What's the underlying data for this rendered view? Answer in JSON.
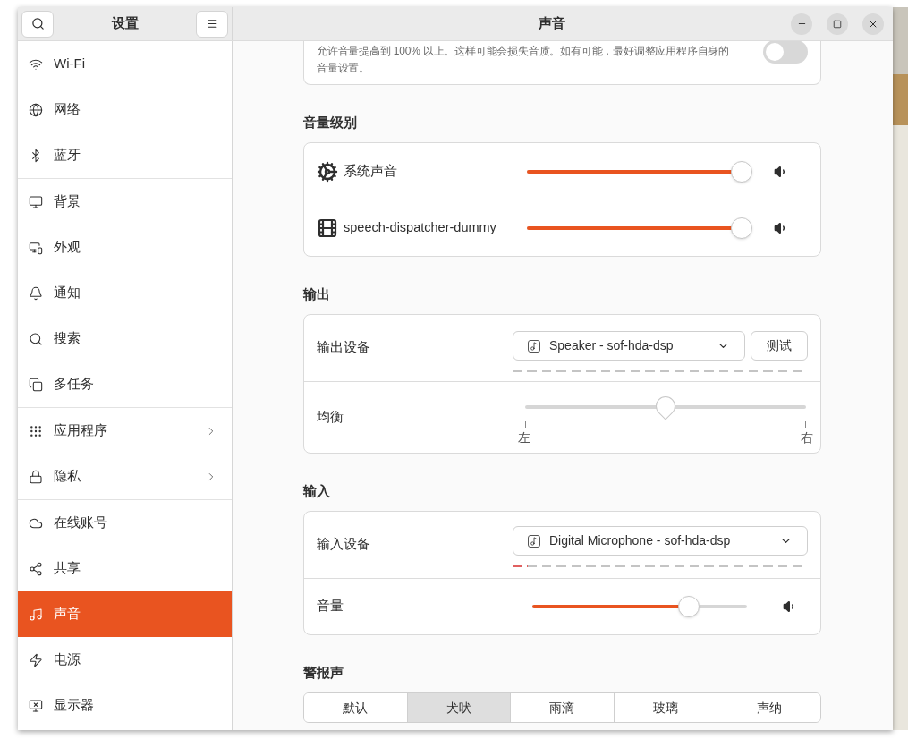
{
  "sidebar": {
    "title": "设置",
    "groups": [
      [
        {
          "label": "Wi-Fi",
          "selected": false,
          "submenu": false
        },
        {
          "label": "网络",
          "selected": false,
          "submenu": false
        },
        {
          "label": "蓝牙",
          "selected": false,
          "submenu": false
        }
      ],
      [
        {
          "label": "背景",
          "selected": false,
          "submenu": false
        },
        {
          "label": "外观",
          "selected": false,
          "submenu": false
        },
        {
          "label": "通知",
          "selected": false,
          "submenu": false
        },
        {
          "label": "搜索",
          "selected": false,
          "submenu": false
        },
        {
          "label": "多任务",
          "selected": false,
          "submenu": false
        }
      ],
      [
        {
          "label": "应用程序",
          "selected": false,
          "submenu": true
        },
        {
          "label": "隐私",
          "selected": false,
          "submenu": true
        }
      ],
      [
        {
          "label": "在线账号",
          "selected": false,
          "submenu": false
        },
        {
          "label": "共享",
          "selected": false,
          "submenu": false
        },
        {
          "label": "声音",
          "selected": true,
          "submenu": false
        },
        {
          "label": "电源",
          "selected": false,
          "submenu": false
        },
        {
          "label": "显示器",
          "selected": false,
          "submenu": false
        }
      ]
    ]
  },
  "window": {
    "title": "声音"
  },
  "overamplification": {
    "description": "允许音量提高到 100% 以上。这样可能会损失音质。如有可能，最好调整应用程序自身的音量设置。",
    "on": false
  },
  "volume_levels": {
    "heading": "音量级别",
    "rows": [
      {
        "name": "系统声音",
        "level": 1.0
      },
      {
        "name": "speech-dispatcher-dummy",
        "level": 1.0
      }
    ]
  },
  "output": {
    "heading": "输出",
    "device_label": "输出设备",
    "device": "Speaker - sof-hda-dsp",
    "test_button": "测试",
    "meter": {
      "level": 0
    },
    "balance_label": "均衡",
    "balance": {
      "level": 0.5,
      "left": "左",
      "right": "右"
    }
  },
  "input": {
    "heading": "输入",
    "device_label": "输入设备",
    "device": "Digital Microphone - sof-hda-dsp",
    "meter": {
      "level": 0.05
    },
    "volume_label": "音量",
    "volume": {
      "level": 0.73
    }
  },
  "alert_sound": {
    "heading": "警报声",
    "options": [
      {
        "label": "默认",
        "selected": false
      },
      {
        "label": "犬吠",
        "selected": true
      },
      {
        "label": "雨滴",
        "selected": false
      },
      {
        "label": "玻璃",
        "selected": false
      },
      {
        "label": "声纳",
        "selected": false
      }
    ]
  }
}
